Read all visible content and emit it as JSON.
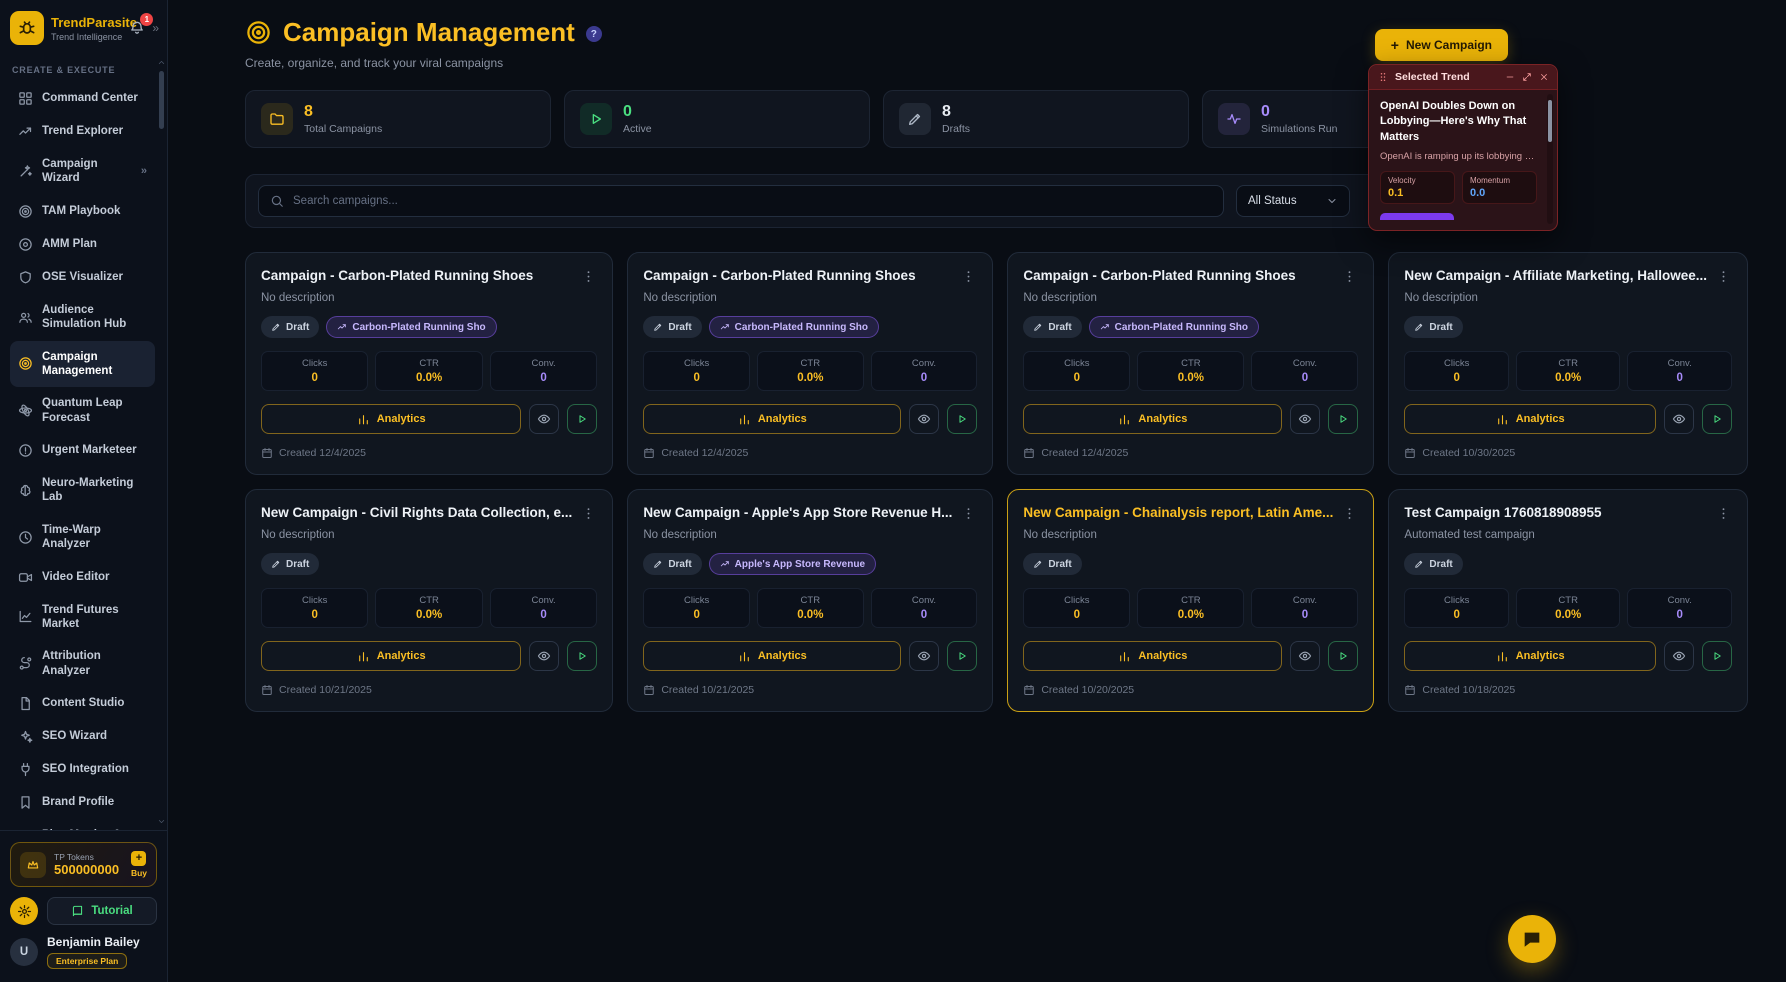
{
  "theme": {
    "accent": "#eab308",
    "success": "#4ade80",
    "purple": "#a78bfa",
    "panel_red": "#7f1d1d",
    "info_blue": "#60a5fa"
  },
  "app": {
    "name": "TrendParasite",
    "tagline": "Trend Intelligence",
    "notifications": "1"
  },
  "sidebar": {
    "section": "CREATE & EXECUTE",
    "items": [
      {
        "label": "Command Center",
        "icon": "grid"
      },
      {
        "label": "Trend Explorer",
        "icon": "trend"
      },
      {
        "label": "Campaign Wizard",
        "icon": "wand",
        "trailing": true
      },
      {
        "label": "TAM Playbook",
        "icon": "target"
      },
      {
        "label": "AMM Plan",
        "icon": "circledot"
      },
      {
        "label": "OSE Visualizer",
        "icon": "shield"
      },
      {
        "label": "Audience Simulation Hub",
        "icon": "users"
      },
      {
        "label": "Campaign Management",
        "icon": "target",
        "active": true
      },
      {
        "label": "Quantum Leap Forecast",
        "icon": "atom"
      },
      {
        "label": "Urgent Marketeer",
        "icon": "alert"
      },
      {
        "label": "Neuro-Marketing Lab",
        "icon": "brain"
      },
      {
        "label": "Time-Warp Analyzer",
        "icon": "clock"
      },
      {
        "label": "Video Editor",
        "icon": "video"
      },
      {
        "label": "Trend Futures Market",
        "icon": "chartline"
      },
      {
        "label": "Attribution Analyzer",
        "icon": "route"
      },
      {
        "label": "Content Studio",
        "icon": "doc"
      },
      {
        "label": "SEO Wizard",
        "icon": "sparkles"
      },
      {
        "label": "SEO Integration",
        "icon": "plug"
      },
      {
        "label": "Brand Profile",
        "icon": "bookmark"
      },
      {
        "label": "Plan Metrics & Config",
        "icon": "sliders"
      }
    ],
    "tokens": {
      "label": "TP Tokens",
      "value": "500000000",
      "buy": "Buy"
    },
    "tutorial": "Tutorial",
    "user": {
      "name": "Benjamin Bailey",
      "plan": "Enterprise Plan",
      "initial": "U"
    }
  },
  "header": {
    "title": "Campaign Management",
    "subtitle": "Create, organize, and track your viral campaigns",
    "new_campaign": "New Campaign"
  },
  "stats": [
    {
      "value": "8",
      "label": "Total Campaigns",
      "icon": "folder",
      "tone": "amber"
    },
    {
      "value": "0",
      "label": "Active",
      "icon": "play",
      "tone": "green"
    },
    {
      "value": "8",
      "label": "Drafts",
      "icon": "pencil",
      "tone": "gray"
    },
    {
      "value": "0",
      "label": "Simulations Run",
      "icon": "pulse",
      "tone": "purple"
    }
  ],
  "toolbar": {
    "search_placeholder": "Search campaigns...",
    "status": "All Status"
  },
  "trend_panel": {
    "title": "Selected Trend",
    "headline": "OpenAI Doubles Down on Lobbying—Here's Why That Matters",
    "description": "OpenAI is ramping up its lobbying game like...",
    "metrics": [
      {
        "label": "Velocity",
        "value": "0.1",
        "tone": "amber"
      },
      {
        "label": "Momentum",
        "value": "0.0",
        "tone": "blue"
      }
    ]
  },
  "cards": [
    {
      "title": "Campaign - Carbon-Plated Running Shoes",
      "description": "No description",
      "status": "Draft",
      "trend_badge": "Carbon-Plated Running Sho",
      "created": "Created 12/4/2025",
      "selected": false,
      "analytics_label": "Analytics",
      "metrics": [
        {
          "label": "Clicks",
          "value": "0",
          "tone": "amber"
        },
        {
          "label": "CTR",
          "value": "0.0%",
          "tone": "amber"
        },
        {
          "label": "Conv.",
          "value": "0",
          "tone": "purple"
        }
      ]
    },
    {
      "title": "Campaign - Carbon-Plated Running Shoes",
      "description": "No description",
      "status": "Draft",
      "trend_badge": "Carbon-Plated Running Sho",
      "created": "Created 12/4/2025",
      "selected": false,
      "analytics_label": "Analytics",
      "metrics": [
        {
          "label": "Clicks",
          "value": "0",
          "tone": "amber"
        },
        {
          "label": "CTR",
          "value": "0.0%",
          "tone": "amber"
        },
        {
          "label": "Conv.",
          "value": "0",
          "tone": "purple"
        }
      ]
    },
    {
      "title": "Campaign - Carbon-Plated Running Shoes",
      "description": "No description",
      "status": "Draft",
      "trend_badge": "Carbon-Plated Running Sho",
      "created": "Created 12/4/2025",
      "selected": false,
      "analytics_label": "Analytics",
      "metrics": [
        {
          "label": "Clicks",
          "value": "0",
          "tone": "amber"
        },
        {
          "label": "CTR",
          "value": "0.0%",
          "tone": "amber"
        },
        {
          "label": "Conv.",
          "value": "0",
          "tone": "purple"
        }
      ]
    },
    {
      "title": "New Campaign - Affiliate Marketing, Hallowee...",
      "description": "No description",
      "status": "Draft",
      "trend_badge": null,
      "created": "Created 10/30/2025",
      "selected": false,
      "analytics_label": "Analytics",
      "metrics": [
        {
          "label": "Clicks",
          "value": "0",
          "tone": "amber"
        },
        {
          "label": "CTR",
          "value": "0.0%",
          "tone": "amber"
        },
        {
          "label": "Conv.",
          "value": "0",
          "tone": "purple"
        }
      ]
    },
    {
      "title": "New Campaign - Civil Rights Data Collection, e...",
      "description": "No description",
      "status": "Draft",
      "trend_badge": null,
      "created": "Created 10/21/2025",
      "selected": false,
      "analytics_label": "Analytics",
      "metrics": [
        {
          "label": "Clicks",
          "value": "0",
          "tone": "amber"
        },
        {
          "label": "CTR",
          "value": "0.0%",
          "tone": "amber"
        },
        {
          "label": "Conv.",
          "value": "0",
          "tone": "purple"
        }
      ]
    },
    {
      "title": "New Campaign - Apple's App Store Revenue H...",
      "description": "No description",
      "status": "Draft",
      "trend_badge": "Apple's App Store Revenue",
      "created": "Created 10/21/2025",
      "selected": false,
      "analytics_label": "Analytics",
      "metrics": [
        {
          "label": "Clicks",
          "value": "0",
          "tone": "amber"
        },
        {
          "label": "CTR",
          "value": "0.0%",
          "tone": "amber"
        },
        {
          "label": "Conv.",
          "value": "0",
          "tone": "purple"
        }
      ]
    },
    {
      "title": "New Campaign - Chainalysis report, Latin Ame...",
      "description": "No description",
      "status": "Draft",
      "trend_badge": null,
      "created": "Created 10/20/2025",
      "selected": true,
      "analytics_label": "Analytics",
      "metrics": [
        {
          "label": "Clicks",
          "value": "0",
          "tone": "amber"
        },
        {
          "label": "CTR",
          "value": "0.0%",
          "tone": "amber"
        },
        {
          "label": "Conv.",
          "value": "0",
          "tone": "purple"
        }
      ]
    },
    {
      "title": "Test Campaign 1760818908955",
      "description": "Automated test campaign",
      "status": "Draft",
      "trend_badge": null,
      "created": "Created 10/18/2025",
      "selected": false,
      "analytics_label": "Analytics",
      "metrics": [
        {
          "label": "Clicks",
          "value": "0",
          "tone": "amber"
        },
        {
          "label": "CTR",
          "value": "0.0%",
          "tone": "amber"
        },
        {
          "label": "Conv.",
          "value": "0",
          "tone": "purple"
        }
      ]
    }
  ]
}
